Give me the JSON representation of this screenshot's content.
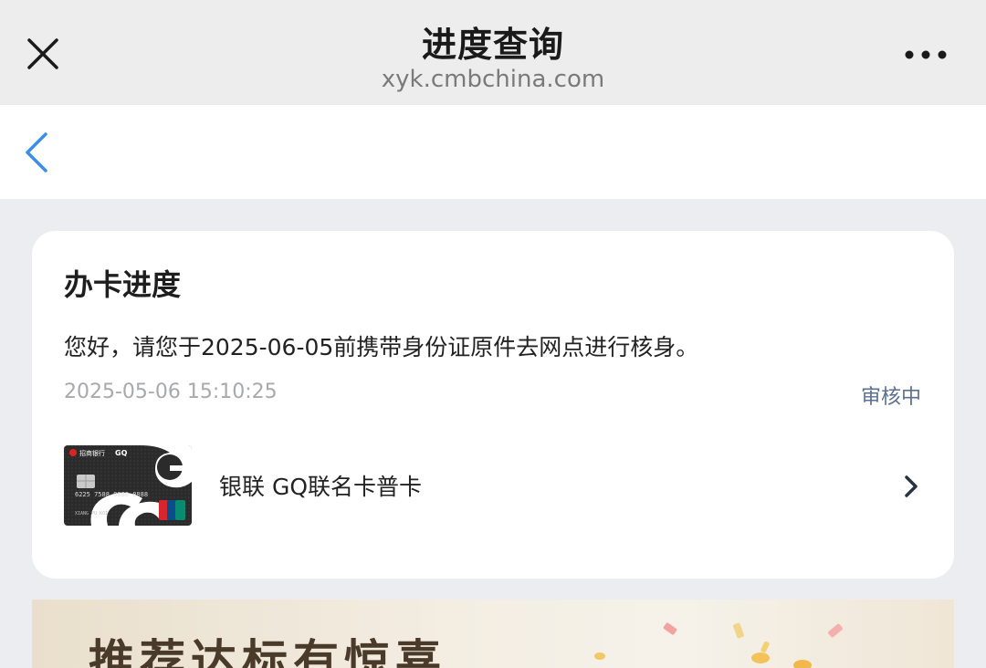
{
  "topbar": {
    "title": "进度查询",
    "domain": "xyk.cmbchina.com",
    "close_icon": "close-icon",
    "more_icon": "more-horizontal-icon"
  },
  "navbar": {
    "back_icon": "chevron-left-icon"
  },
  "card": {
    "title": "办卡进度",
    "message": "您好，请您于2025-06-05前携带身份证原件去网点进行核身。",
    "timestamp": "2025-05-06 15:10:25",
    "status": "审核中",
    "product": {
      "name": "银联 GQ联名卡普卡",
      "card_image_text": {
        "bank": "招商银行",
        "brand": "GQ",
        "number": "6225 7588 8888 8888",
        "holder": "XIANG PU KOI",
        "network": "UnionPay 银联"
      }
    }
  },
  "banner": {
    "text": "推荐达标有惊喜"
  },
  "colors": {
    "accent_blue": "#3a8ee6",
    "status_text": "#5b7090",
    "background": "#ebedf0"
  }
}
